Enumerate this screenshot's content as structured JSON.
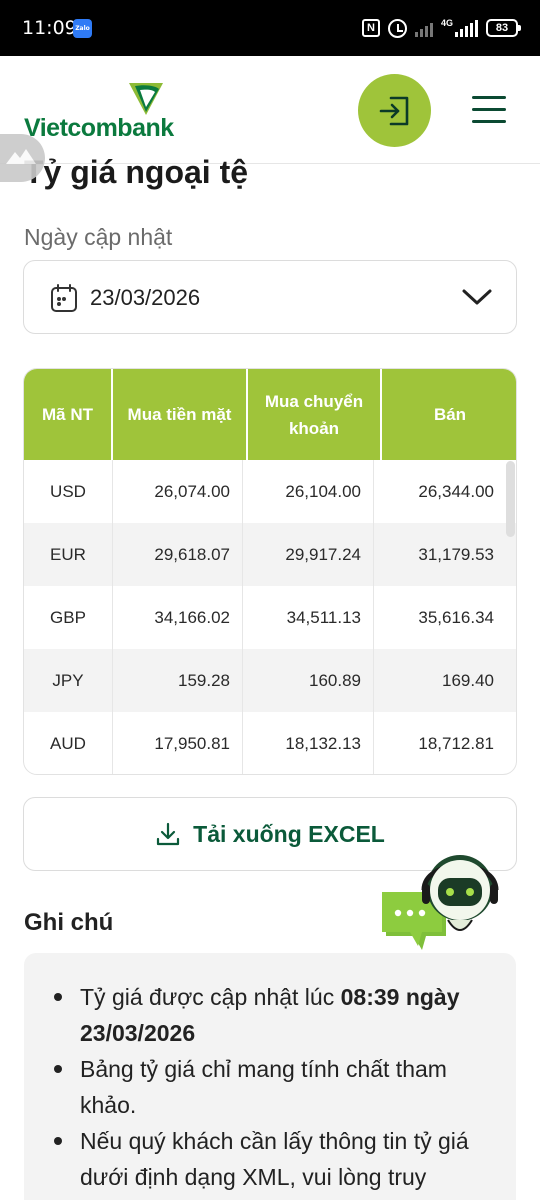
{
  "status_bar": {
    "time": "11:09",
    "zalo_label": "Zalo",
    "nfc_label": "N",
    "network": "4G",
    "battery": "83"
  },
  "header": {
    "brand": "Vietcombank",
    "accent_color": "#9fc43a",
    "brand_color": "#0b7a3e"
  },
  "page": {
    "title": "Tỷ giá ngoại tệ",
    "date_label": "Ngày cập nhật",
    "date_value": "23/03/2026"
  },
  "table": {
    "headers": [
      "Mã NT",
      "Mua tiền mặt",
      "Mua chuyển khoản",
      "Bán"
    ],
    "rows": [
      {
        "code": "USD",
        "cash": "26,074.00",
        "transfer": "26,104.00",
        "sell": "26,344.00"
      },
      {
        "code": "EUR",
        "cash": "29,618.07",
        "transfer": "29,917.24",
        "sell": "31,179.53"
      },
      {
        "code": "GBP",
        "cash": "34,166.02",
        "transfer": "34,511.13",
        "sell": "35,616.34"
      },
      {
        "code": "JPY",
        "cash": "159.28",
        "transfer": "160.89",
        "sell": "169.40"
      },
      {
        "code": "AUD",
        "cash": "17,950.81",
        "transfer": "18,132.13",
        "sell": "18,712.81"
      }
    ]
  },
  "excel_button": "Tải xuống EXCEL",
  "notes": {
    "title": "Ghi chú",
    "item1_pre": "Tỷ giá được cập nhật lúc ",
    "item1_bold": "08:39 ngày 23/03/2026",
    "item2": "Bảng tỷ giá chỉ mang tính chất tham khảo.",
    "item3": "Nếu quý khách cần lấy thông tin tỷ giá dưới định dạng XML, vui lòng truy"
  }
}
